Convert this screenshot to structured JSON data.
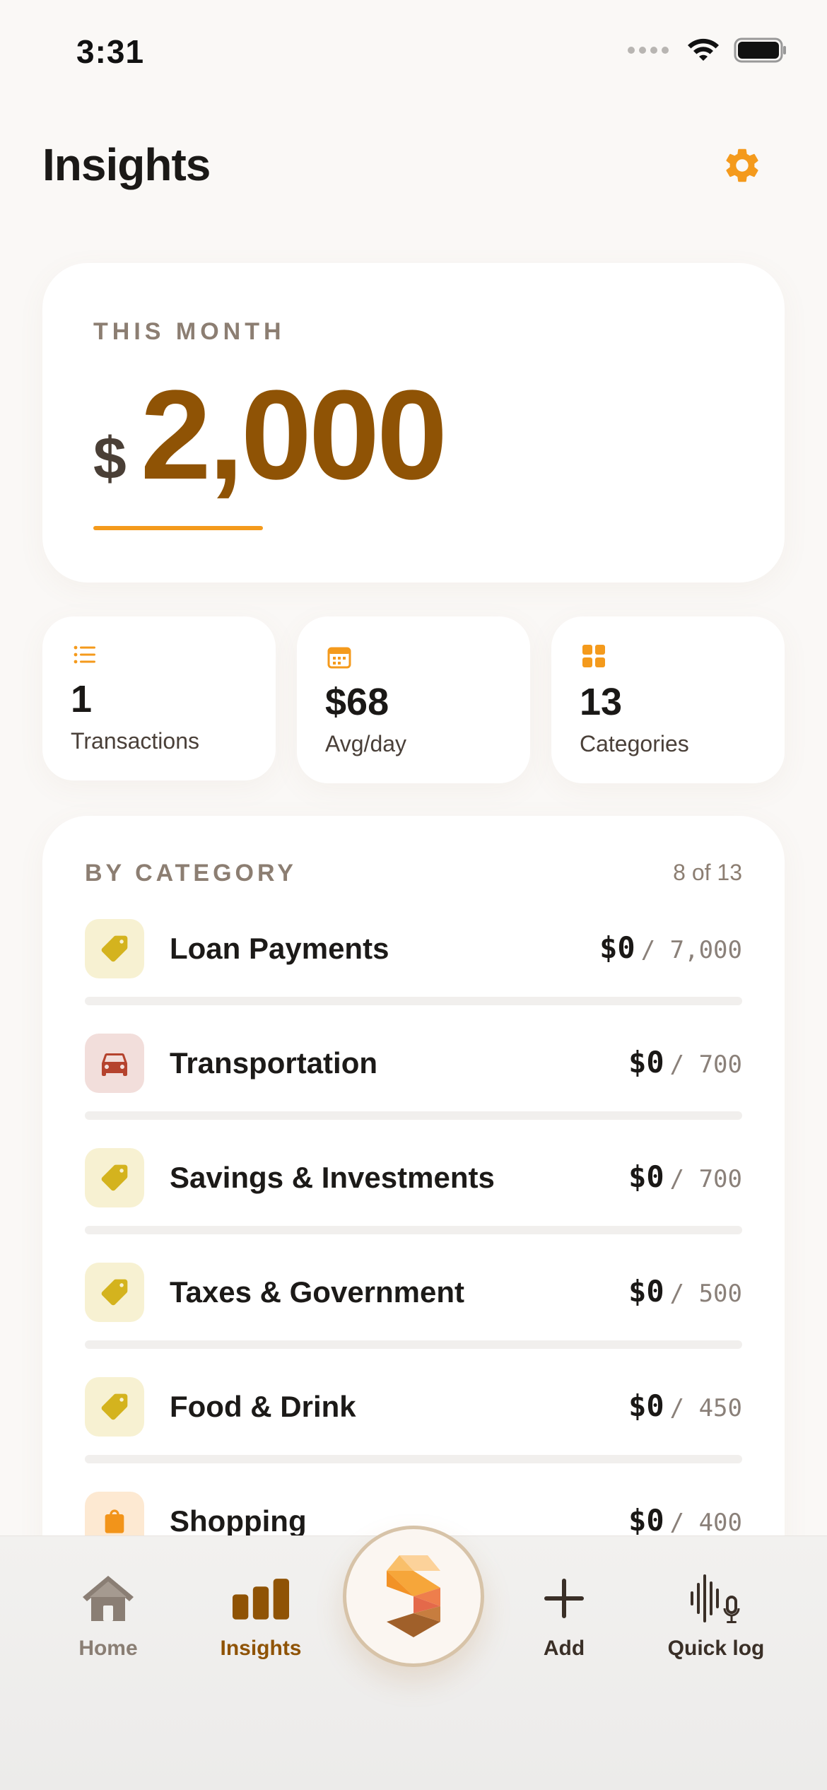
{
  "status_bar": {
    "time": "3:31"
  },
  "header": {
    "title": "Insights"
  },
  "month_card": {
    "label": "THIS MONTH",
    "currency": "$",
    "amount": "2,000"
  },
  "stats": [
    {
      "value": "1",
      "label": "Transactions",
      "icon": "list-icon"
    },
    {
      "value": "$68",
      "label": "Avg/day",
      "icon": "calendar-icon"
    },
    {
      "value": "13",
      "label": "Categories",
      "icon": "grid-icon"
    }
  ],
  "category_section": {
    "header": "BY CATEGORY",
    "count": "8 of 13",
    "items": [
      {
        "name": "Loan Payments",
        "spent": "$0",
        "budget": "/ 7,000",
        "progress": 0,
        "icon": "tag-icon",
        "icon_bg": "#f7f1d2",
        "icon_color": "#d4b31e"
      },
      {
        "name": "Transportation",
        "spent": "$0",
        "budget": "/ 700",
        "progress": 0,
        "icon": "car-icon",
        "icon_bg": "#f2dedb",
        "icon_color": "#b5432e"
      },
      {
        "name": "Savings & Investments",
        "spent": "$0",
        "budget": "/ 700",
        "progress": 0,
        "icon": "tag-icon",
        "icon_bg": "#f7f1d2",
        "icon_color": "#d4b31e"
      },
      {
        "name": "Taxes & Government",
        "spent": "$0",
        "budget": "/ 500",
        "progress": 0,
        "icon": "tag-icon",
        "icon_bg": "#f7f1d2",
        "icon_color": "#d4b31e"
      },
      {
        "name": "Food & Drink",
        "spent": "$0",
        "budget": "/ 450",
        "progress": 0,
        "icon": "tag-icon",
        "icon_bg": "#f7f1d2",
        "icon_color": "#d4b31e"
      },
      {
        "name": "Shopping",
        "spent": "$0",
        "budget": "/ 400",
        "progress": 0,
        "icon": "bag-icon",
        "icon_bg": "#fde9d2",
        "icon_color": "#f2941a"
      }
    ]
  },
  "bottom_nav": {
    "home": "Home",
    "insights": "Insights",
    "add": "Add",
    "quick_log": "Quick log"
  },
  "colors": {
    "accent": "#f49a1c",
    "amount": "#8f5305",
    "muted": "#8c7e72"
  }
}
